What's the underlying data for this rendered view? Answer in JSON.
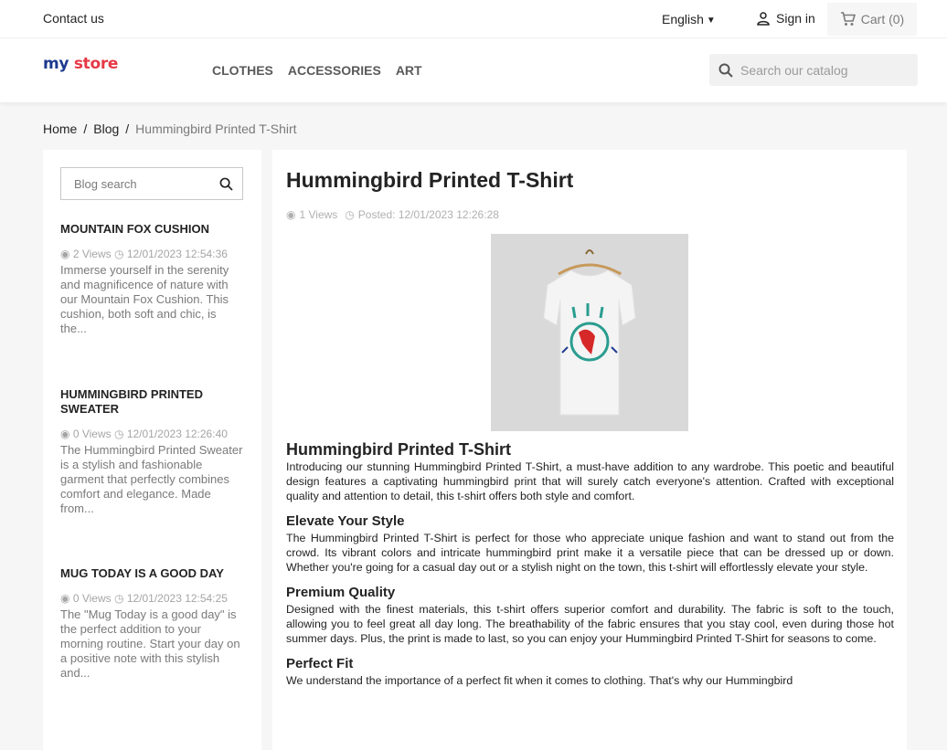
{
  "topbar": {
    "contact": "Contact us",
    "language": "English",
    "signin": "Sign in",
    "cart": "Cart (0)"
  },
  "header": {
    "logo_part1": "my",
    "logo_part2": "store",
    "nav": [
      "CLOTHES",
      "ACCESSORIES",
      "ART"
    ],
    "search_placeholder": "Search our catalog"
  },
  "breadcrumb": [
    "Home",
    "Blog",
    "Hummingbird Printed T-Shirt"
  ],
  "sidebar": {
    "search_placeholder": "Blog search",
    "posts": [
      {
        "title": "MOUNTAIN FOX CUSHION",
        "views": "2 Views",
        "date": "12/01/2023 12:54:36",
        "excerpt": "Immerse yourself in the serenity and magnificence of nature with our Mountain Fox Cushion. This cushion, both soft and chic, is the..."
      },
      {
        "title": "HUMMINGBIRD PRINTED SWEATER",
        "views": "0 Views",
        "date": "12/01/2023 12:26:40",
        "excerpt": "The Hummingbird Printed Sweater is a stylish and fashionable garment that perfectly combines comfort and elegance. Made from..."
      },
      {
        "title": "MUG TODAY IS A GOOD DAY",
        "views": "0 Views",
        "date": "12/01/2023 12:54:25",
        "excerpt": "The \"Mug Today is a good day\" is the perfect addition to your morning routine. Start your day on a positive note with this stylish and..."
      }
    ]
  },
  "article": {
    "title": "Hummingbird Printed T-Shirt",
    "views": "1 Views",
    "posted": "Posted: 12/01/2023 12:26:28",
    "heading": "Hummingbird Printed T-Shirt",
    "intro": "Introducing our stunning Hummingbird Printed T-Shirt, a must-have addition to any wardrobe. This poetic and beautiful design features a captivating hummingbird print that will surely catch everyone's attention. Crafted with exceptional quality and attention to detail, this t-shirt offers both style and comfort.",
    "sections": [
      {
        "heading": "Elevate Your Style",
        "text": "The Hummingbird Printed T-Shirt is perfect for those who appreciate unique fashion and want to stand out from the crowd. Its vibrant colors and intricate hummingbird print make it a versatile piece that can be dressed up or down. Whether you're going for a casual day out or a stylish night on the town, this t-shirt will effortlessly elevate your style."
      },
      {
        "heading": "Premium Quality",
        "text": "Designed with the finest materials, this t-shirt offers superior comfort and durability. The fabric is soft to the touch, allowing you to feel great all day long. The breathability of the fabric ensures that you stay cool, even during those hot summer days. Plus, the print is made to last, so you can enjoy your Hummingbird Printed T-Shirt for seasons to come."
      },
      {
        "heading": "Perfect Fit",
        "text": "We understand the importance of a perfect fit when it comes to clothing. That's why our Hummingbird"
      }
    ]
  },
  "colors": {
    "logo_primary": "#1d3a8f",
    "logo_accent": "#e63946",
    "page_bg": "#f6f6f6",
    "muted_text": "#7a7a7a"
  }
}
